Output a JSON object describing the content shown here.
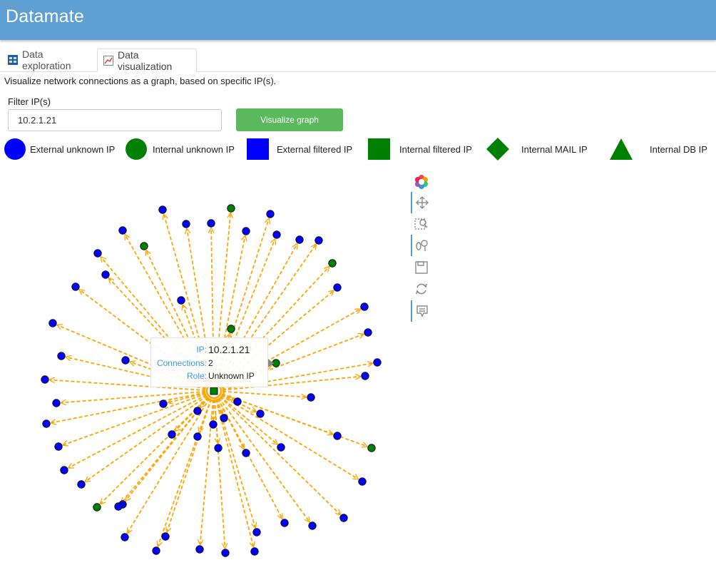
{
  "app": {
    "title": "Datamate"
  },
  "tabs": [
    {
      "label": "Data exploration",
      "icon": "table-icon",
      "active": false
    },
    {
      "label": "Data visualization",
      "icon": "chart-icon",
      "active": true
    }
  ],
  "description": "Visualize network connections as a graph, based on specific IP(s).",
  "filter": {
    "label": "Filter IP(s)",
    "value": "10.2.1.21",
    "placeholder": ""
  },
  "button": {
    "label": "Visualize graph"
  },
  "legend": [
    {
      "label": "External unknown IP",
      "shape": "circle",
      "color": "#0000ff"
    },
    {
      "label": "Internal unknown IP",
      "shape": "circle",
      "color": "#008000"
    },
    {
      "label": "External filtered IP",
      "shape": "square",
      "color": "#0000ff"
    },
    {
      "label": "Internal filtered IP",
      "shape": "square",
      "color": "#008000"
    },
    {
      "label": "Internal MAIL IP",
      "shape": "diamond",
      "color": "#008000"
    },
    {
      "label": "Internal DB IP",
      "shape": "triangle",
      "color": "#008000"
    }
  ],
  "toolbar": [
    {
      "name": "bokeh-logo-icon",
      "active": false
    },
    {
      "name": "pan-icon",
      "active": true
    },
    {
      "name": "box-zoom-icon",
      "active": false
    },
    {
      "name": "wheel-zoom-icon",
      "active": true
    },
    {
      "name": "save-icon",
      "active": false
    },
    {
      "name": "reset-icon",
      "active": false
    },
    {
      "name": "hover-icon",
      "active": true
    }
  ],
  "tooltip": {
    "ip_label": "IP:",
    "ip_value": "10.2.1.21",
    "connections_label": "Connections:",
    "connections_value": "2",
    "role_label": "Role:",
    "role_value": "Unknown IP"
  },
  "graph": {
    "center_color": "#008000",
    "edge_color": "#ffa500",
    "external_color": "#0000ff",
    "internal_color": "#008000"
  }
}
